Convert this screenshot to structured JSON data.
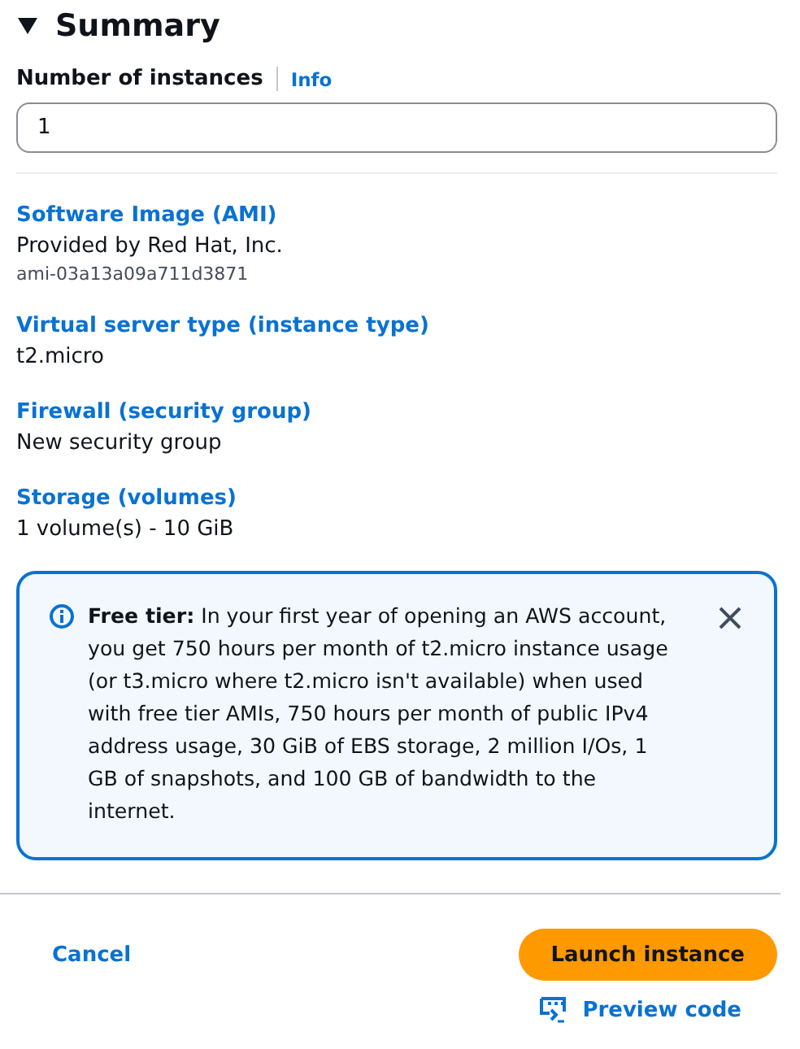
{
  "summary": {
    "title": "Summary",
    "expanded": true
  },
  "instances": {
    "label": "Number of instances",
    "info": "Info",
    "value": "1"
  },
  "details": [
    {
      "heading": "Software Image (AMI)",
      "value": "Provided by Red Hat, Inc.",
      "sub": "ami-03a13a09a711d3871"
    },
    {
      "heading": "Virtual server type (instance type)",
      "value": "t2.micro"
    },
    {
      "heading": "Firewall (security group)",
      "value": "New security group"
    },
    {
      "heading": "Storage (volumes)",
      "value": "1 volume(s) - 10 GiB"
    }
  ],
  "alert": {
    "text": "**Free tier:** In your first year of opening an AWS account, you get 750 hours per month of t2.micro instance usage (or t3.micro where t2.micro isn't available) when used with free tier AMIs, 750 hours per month of public IPv4 address usage, 30 GiB of EBS storage, 2 million I/Os, 1 GB of snapshots, and 100 GB of bandwidth to the internet."
  },
  "actions": {
    "cancel": "Cancel",
    "launch": "Launch instance",
    "preview": "Preview code"
  }
}
